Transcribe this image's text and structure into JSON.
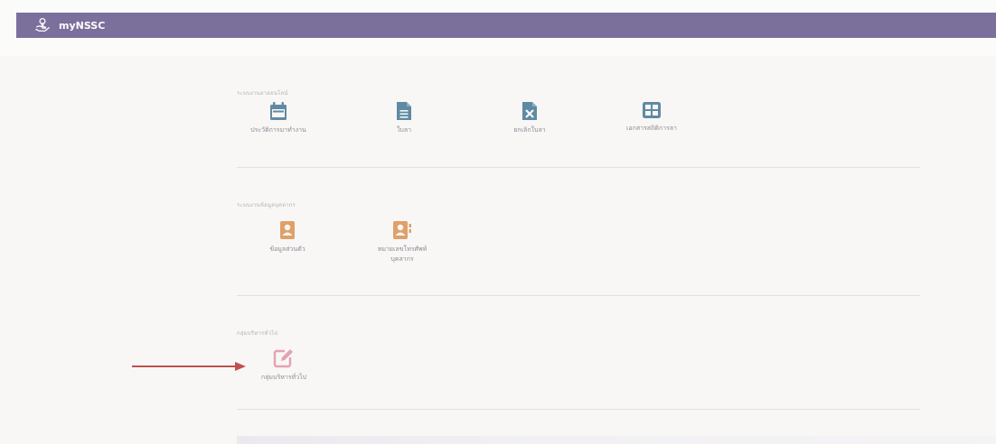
{
  "app": {
    "title": "myNSSC",
    "navbar_color": "#7b6f9c",
    "logo_icon": "hand-coin-icon"
  },
  "sections": [
    {
      "title": "ระบบงานลาออนไลน์",
      "items": [
        {
          "label": "ประวัติการมาทำงาน",
          "icon": "calendar-icon",
          "color": "#5f8aa3"
        },
        {
          "label": "ใบลา",
          "icon": "document-icon",
          "color": "#5f8aa3"
        },
        {
          "label": "ยกเลิกใบลา",
          "icon": "excel-file-icon",
          "color": "#5f8aa3"
        },
        {
          "label": "เอกสารสถิติการลา",
          "icon": "table-icon",
          "color": "#5f8aa3"
        }
      ]
    },
    {
      "title": "ระบบงานข้อมูลบุคลากร",
      "items": [
        {
          "label": "ข้อมูลส่วนตัว",
          "icon": "person-card-icon",
          "color": "#e0a06a"
        },
        {
          "label": "หมายเลขโทรศัพท์\nบุคลากร",
          "icon": "contact-book-icon",
          "color": "#e0a06a"
        }
      ]
    },
    {
      "title": "กลุ่มบริหารทั่วไป",
      "items": [
        {
          "label": "กลุ่มบริหารทั่วไป",
          "icon": "edit-icon",
          "color": "#e6a1b2"
        }
      ]
    }
  ],
  "annotation": {
    "arrow_color": "#c0504d"
  }
}
